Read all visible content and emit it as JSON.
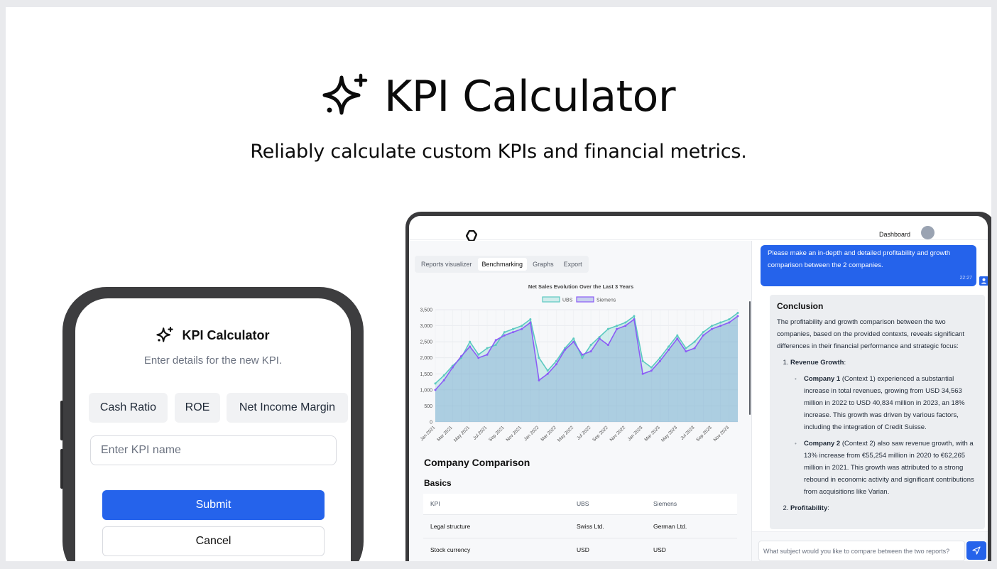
{
  "hero": {
    "title": "KPI Calculator",
    "subtitle": "Reliably calculate custom KPIs and financial metrics."
  },
  "phone": {
    "title": "KPI Calculator",
    "subtitle": "Enter details for the new KPI.",
    "chips": [
      "Cash Ratio",
      "ROE",
      "Net Income Margin"
    ],
    "input_placeholder": "Enter KPI name",
    "submit_label": "Submit",
    "cancel_label": "Cancel"
  },
  "app": {
    "nav_label": "Dashboard",
    "tabs": [
      {
        "label": "Reports visualizer",
        "active": false
      },
      {
        "label": "Benchmarking",
        "active": true
      },
      {
        "label": "Graphs",
        "active": false
      },
      {
        "label": "Export",
        "active": false
      }
    ],
    "comparison": {
      "title": "Company Comparison",
      "section": "Basics",
      "headers": [
        "KPI",
        "UBS",
        "Siemens"
      ],
      "rows": [
        [
          "Legal structure",
          "Swiss Ltd.",
          "German Ltd."
        ],
        [
          "Stock currency",
          "USD",
          "USD"
        ]
      ]
    },
    "chat": {
      "user_message": "Please make an in-depth and detailed profitability and growth comparison between the 2 companies.",
      "user_time": "22:27",
      "answer_heading": "Conclusion",
      "answer_intro": "The profitability and growth comparison between the two companies, based on the provided contexts, reveals significant differences in their financial performance and strategic focus:",
      "item1_title": "Revenue Growth",
      "item1_bullets": [
        {
          "lead": "Company 1",
          "text": " (Context 1) experienced a substantial increase in total revenues, growing from USD 34,563 million in 2022 to USD 40,834 million in 2023, an 18% increase. This growth was driven by various factors, including the integration of Credit Suisse."
        },
        {
          "lead": "Company 2",
          "text": " (Context 2) also saw revenue growth, with a 13% increase from €55,254 million in 2020 to €62,265 million in 2021. This growth was attributed to a strong rebound in economic activity and significant contributions from acquisitions like Varian."
        }
      ],
      "item2_title": "Profitability",
      "input_placeholder": "What subject would you like to compare between the two reports?"
    }
  },
  "chart_data": {
    "type": "area",
    "title": "Net Sales Evolution Over the Last 3 Years",
    "xlabel": "",
    "ylabel": "",
    "ylim": [
      0,
      3500
    ],
    "yticks": [
      "3,500",
      "3,000",
      "2,500",
      "2,000",
      "1,500",
      "1,000",
      "500",
      "0"
    ],
    "xtick_labels": [
      "Jan 2021",
      "Mar 2021",
      "May 2021",
      "Jul 2021",
      "Sep 2021",
      "Nov 2021",
      "Jan 2022",
      "Mar 2022",
      "May 2022",
      "Jul 2022",
      "Sep 2022",
      "Nov 2022",
      "Jan 2023",
      "Mar 2023",
      "May 2023",
      "Jul 2023",
      "Sep 2023",
      "Nov 2023"
    ],
    "x": [
      "Jan 2021",
      "Feb 2021",
      "Mar 2021",
      "Apr 2021",
      "May 2021",
      "Jun 2021",
      "Jul 2021",
      "Aug 2021",
      "Sep 2021",
      "Oct 2021",
      "Nov 2021",
      "Dec 2021",
      "Jan 2022",
      "Feb 2022",
      "Mar 2022",
      "Apr 2022",
      "May 2022",
      "Jun 2022",
      "Jul 2022",
      "Aug 2022",
      "Sep 2022",
      "Oct 2022",
      "Nov 2022",
      "Dec 2022",
      "Jan 2023",
      "Feb 2023",
      "Mar 2023",
      "Apr 2023",
      "May 2023",
      "Jun 2023",
      "Jul 2023",
      "Aug 2023",
      "Sep 2023",
      "Oct 2023",
      "Nov 2023",
      "Dec 2023"
    ],
    "series": [
      {
        "name": "UBS",
        "color": "#5cc9c0",
        "fill": "rgba(92,201,192,0.25)",
        "values": [
          1200,
          1450,
          1750,
          2000,
          2500,
          2100,
          2300,
          2400,
          2800,
          2900,
          3000,
          3200,
          2000,
          1600,
          1900,
          2300,
          2600,
          2000,
          2400,
          2650,
          2900,
          3000,
          3100,
          3300,
          1900,
          1700,
          2000,
          2350,
          2700,
          2300,
          2500,
          2800,
          3000,
          3100,
          3200,
          3400
        ]
      },
      {
        "name": "Siemens",
        "color": "#8b5cf6",
        "fill": "rgba(99,125,210,0.32)",
        "values": [
          1000,
          1300,
          1700,
          2050,
          2350,
          2000,
          2100,
          2550,
          2700,
          2800,
          2900,
          3100,
          1300,
          1500,
          1800,
          2250,
          2500,
          2100,
          2200,
          2600,
          2400,
          2900,
          3000,
          3200,
          1500,
          1600,
          1900,
          2250,
          2600,
          2200,
          2300,
          2700,
          2900,
          3000,
          3100,
          3300
        ]
      }
    ],
    "grid": true,
    "legend": "top"
  }
}
